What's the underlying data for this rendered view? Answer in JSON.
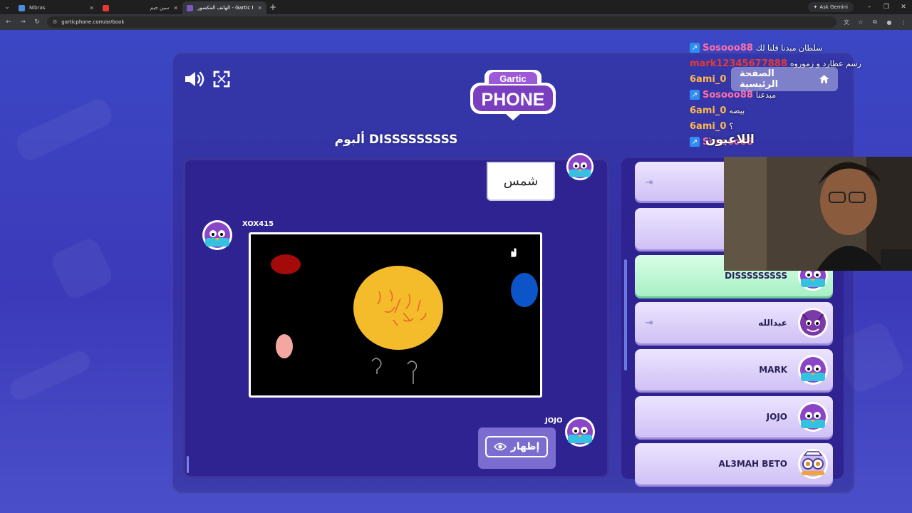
{
  "browser": {
    "tabs": [
      {
        "title": "Nibras",
        "active": false,
        "favicon_color": "#4a90e2"
      },
      {
        "title": "سين جيم",
        "active": false,
        "favicon_color": "#e53935"
      },
      {
        "title": "الهاتف المكسور - Gartic Phone",
        "active": true,
        "favicon_color": "#7e57c2"
      }
    ],
    "url": "garticphone.com/ar/book",
    "gemini_label": "Ask Gemini"
  },
  "game": {
    "logo_top": "Gartic",
    "logo_main": "PHONE",
    "album_title": "ألبوم DISSSSSSSSS",
    "guess_text": "شمس",
    "drawer_name": "XOX415",
    "next_player_name": "JOJO",
    "show_button_label": "إظهار",
    "home_button_label": "الصفحة الرئيسية",
    "players_title": "اللاعبون",
    "players": [
      {
        "name": "",
        "host": false,
        "exit": true
      },
      {
        "name": "",
        "host": false,
        "exit": false
      },
      {
        "name": "DISSSSSSSSS",
        "host": true,
        "exit": false
      },
      {
        "name": "عبدالله",
        "host": false,
        "exit": true
      },
      {
        "name": "MARK",
        "host": false,
        "exit": false
      },
      {
        "name": "JOJO",
        "host": false,
        "exit": false
      },
      {
        "name": "AL3MAH BETO",
        "host": false,
        "exit": false
      }
    ]
  },
  "chat": [
    {
      "user": "Sosooo88",
      "color": "#ff6fa8",
      "message": "سلطان مبدنا قلنا لك"
    },
    {
      "user": "mark12345677888",
      "color": "#e53935",
      "message": "رسم عطارد و زموروه"
    },
    {
      "user": "6ami_0",
      "color": "#ffb84d",
      "message": ""
    },
    {
      "user": "Sosooo88",
      "color": "#ff6fa8",
      "message": "مبدعنا"
    },
    {
      "user": "6ami_0",
      "color": "#ffb84d",
      "message": "بيضه"
    },
    {
      "user": "6ami_0",
      "color": "#ffb84d",
      "message": "؟"
    },
    {
      "user": "Sosooo88",
      "color": "#ff6fa8",
      "message": ""
    }
  ],
  "icons": {
    "volume": "volume-icon",
    "fullscreen": "fullscreen-icon",
    "home": "home-icon",
    "eye": "eye-icon",
    "exit": "exit-icon"
  }
}
